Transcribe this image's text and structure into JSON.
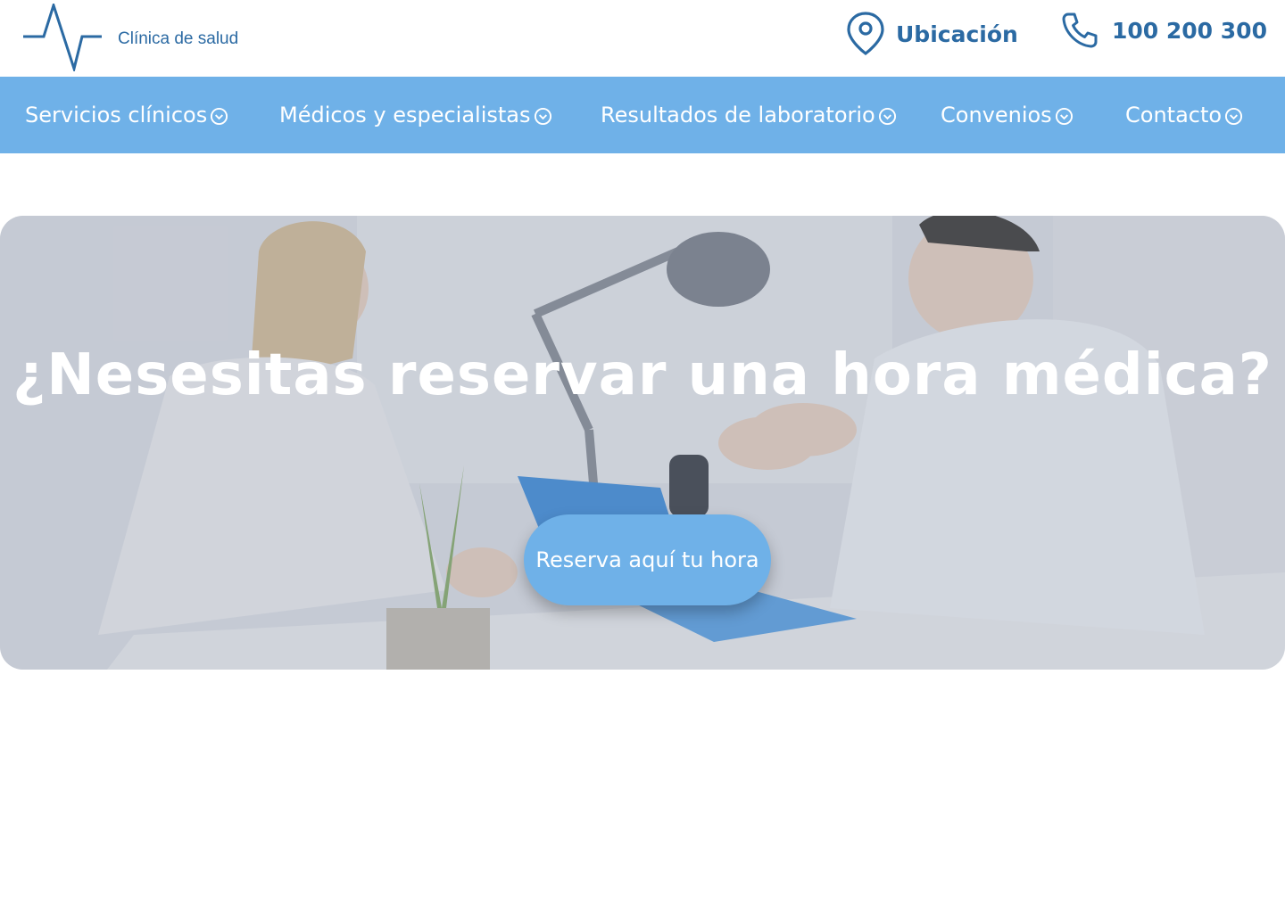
{
  "brand": {
    "name": "Clínica de salud"
  },
  "header": {
    "location_label": "Ubicación",
    "phone_label": "100 200 300"
  },
  "nav": {
    "items": [
      {
        "label": "Servicios clínicos"
      },
      {
        "label": "Médicos y especialistas"
      },
      {
        "label": "Resultados de laboratorio"
      },
      {
        "label": "Convenios"
      },
      {
        "label": "Contacto"
      }
    ]
  },
  "hero": {
    "title": "¿Nesesitas reservar una hora médica?",
    "cta_label": "Reserva aquí tu hora"
  },
  "icons": {
    "logo": "heartbeat-line-icon",
    "location": "location-pin-icon",
    "phone": "phone-icon",
    "nav_chevron": "chevron-down-circle-icon"
  },
  "colors": {
    "brand_dark": "#2b6aa3",
    "nav_background": "#6fb1e8",
    "cta_background": "#6fb1e8",
    "text_light": "#ffffff"
  }
}
